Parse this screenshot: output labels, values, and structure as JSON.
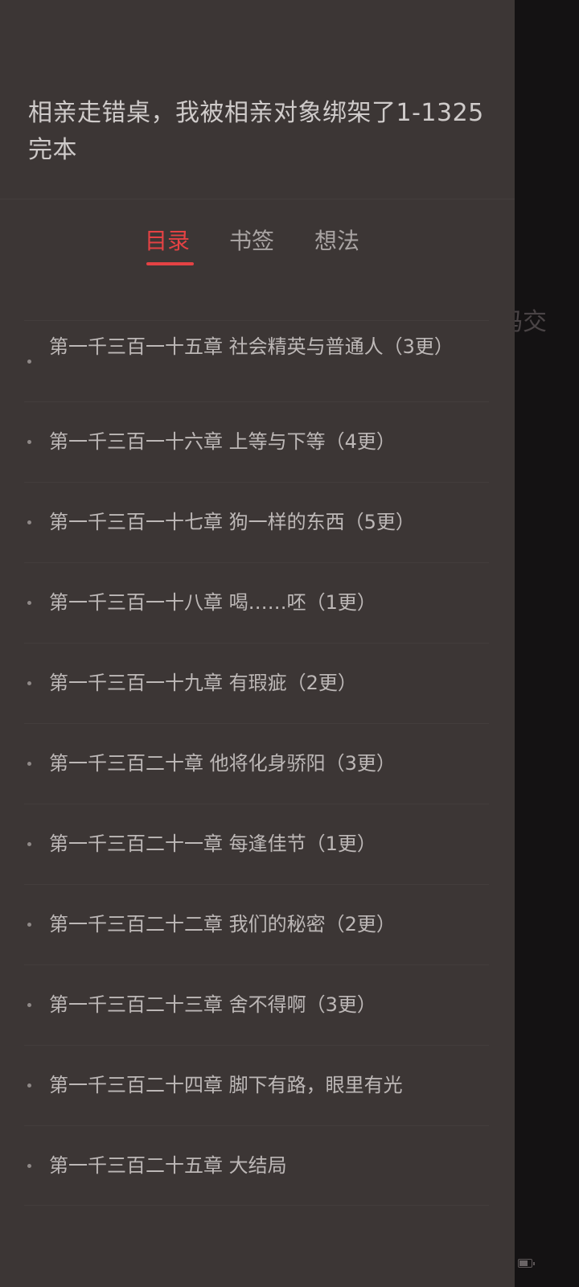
{
  "background": {
    "text_fragment": "码交"
  },
  "drawer": {
    "book_title": "相亲走错桌，我被相亲对象绑架了1-1325完本",
    "tabs": [
      {
        "label": "目录",
        "active": true
      },
      {
        "label": "书签",
        "active": false
      },
      {
        "label": "想法",
        "active": false
      }
    ],
    "chapters": [
      "第一千三百一十五章 社会精英与普通人（3更）",
      "第一千三百一十六章 上等与下等（4更）",
      "第一千三百一十七章 狗一样的东西（5更）",
      "第一千三百一十八章 喝……呸（1更）",
      "第一千三百一十九章 有瑕疵（2更）",
      "第一千三百二十章 他将化身骄阳（3更）",
      "第一千三百二十一章 每逢佳节（1更）",
      "第一千三百二十二章 我们的秘密（2更）",
      "第一千三百二十三章 舍不得啊（3更）",
      "第一千三百二十四章 脚下有路，眼里有光",
      "第一千三百二十五章 大结局"
    ]
  },
  "colors": {
    "drawer_bg": "#3c3635",
    "accent": "#e44244",
    "backdrop": "#141213"
  }
}
